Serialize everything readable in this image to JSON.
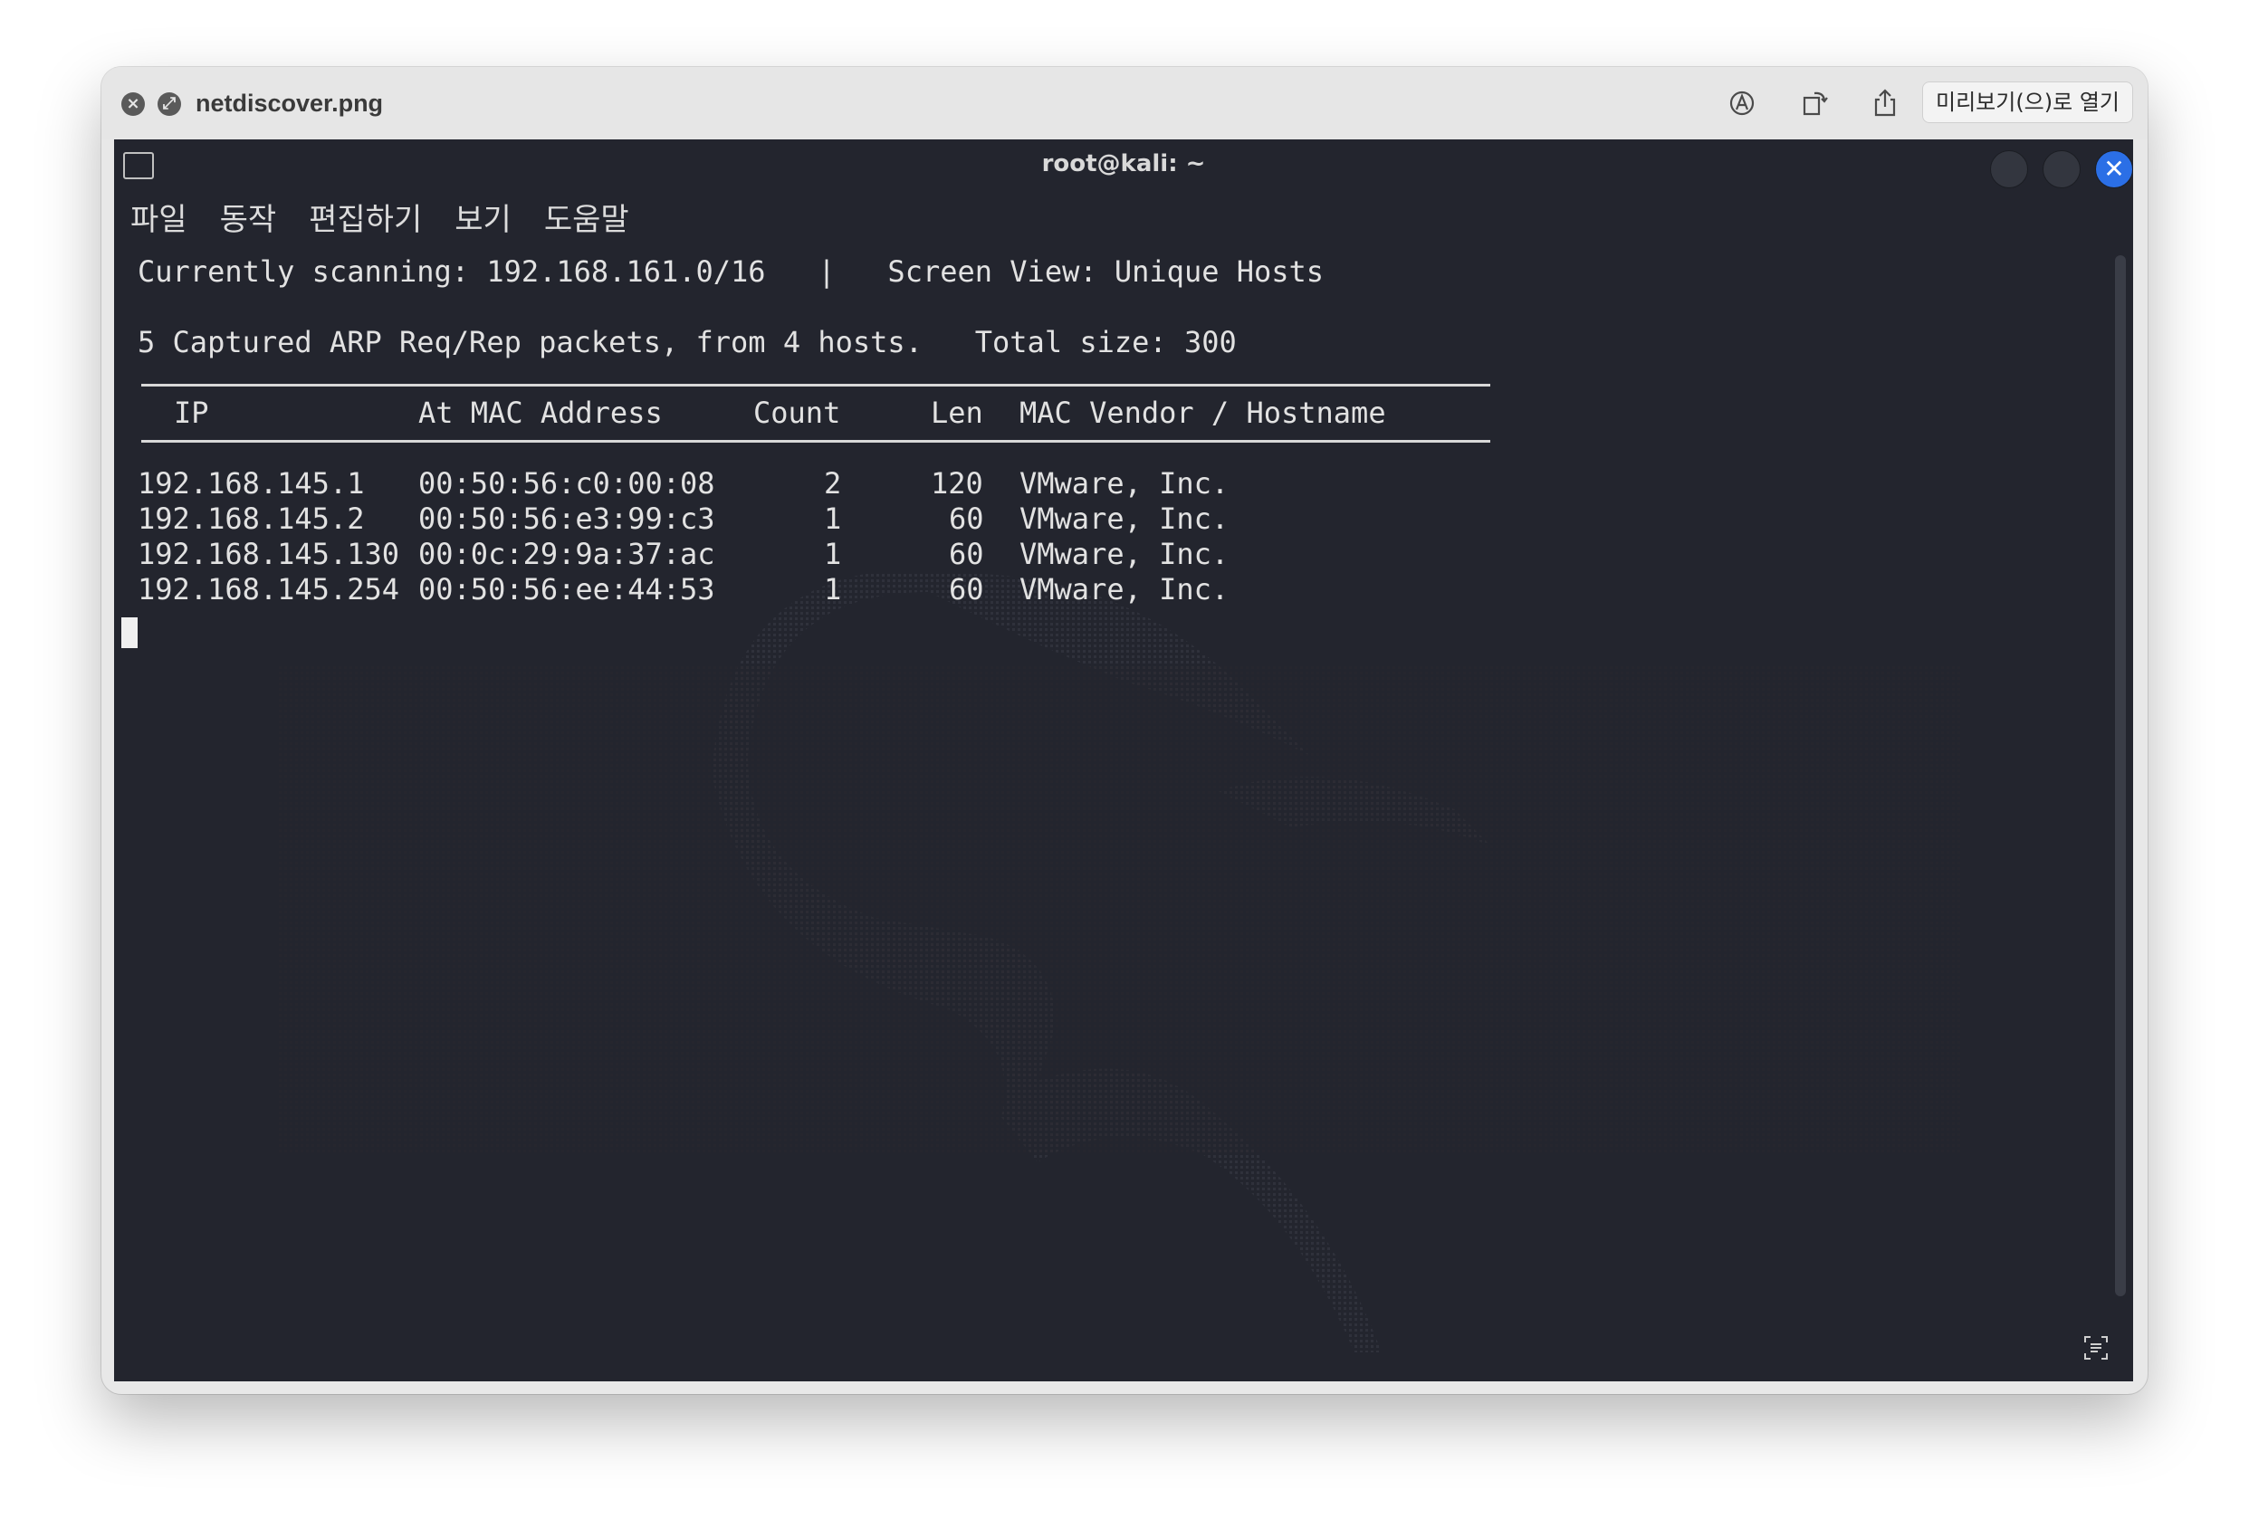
{
  "quicklook": {
    "filename": "netdiscover.png",
    "open_button_label": "미리보기(으)로 열기",
    "icons": [
      "close-icon",
      "fullscreen-icon",
      "markup-icon",
      "rotate-icon",
      "share-icon"
    ]
  },
  "terminal": {
    "title": "root@kali: ~",
    "menu": [
      "파일",
      "동작",
      "편집하기",
      "보기",
      "도움말"
    ],
    "scan_line": "Currently scanning: 192.168.161.0/16   |   Screen View: Unique Hosts",
    "summary_line": "5 Captured ARP Req/Rep packets, from 4 hosts.   Total size: 300",
    "table": {
      "headers": {
        "ip": "IP",
        "mac": "At MAC Address",
        "count": "Count",
        "len": "Len",
        "vendor": "MAC Vendor / Hostname"
      },
      "rows": [
        {
          "ip": "192.168.145.1",
          "mac": "00:50:56:c0:00:08",
          "count": "2",
          "len": "120",
          "vendor": "VMware, Inc."
        },
        {
          "ip": "192.168.145.2",
          "mac": "00:50:56:e3:99:c3",
          "count": "1",
          "len": "60",
          "vendor": "VMware, Inc."
        },
        {
          "ip": "192.168.145.130",
          "mac": "00:0c:29:9a:37:ac",
          "count": "1",
          "len": "60",
          "vendor": "VMware, Inc."
        },
        {
          "ip": "192.168.145.254",
          "mac": "00:50:56:ee:44:53",
          "count": "1",
          "len": "60",
          "vendor": "VMware, Inc."
        }
      ]
    },
    "colors": {
      "background": "#23252e",
      "text": "#e2e2e2",
      "close_button": "#2b6fe6"
    }
  }
}
